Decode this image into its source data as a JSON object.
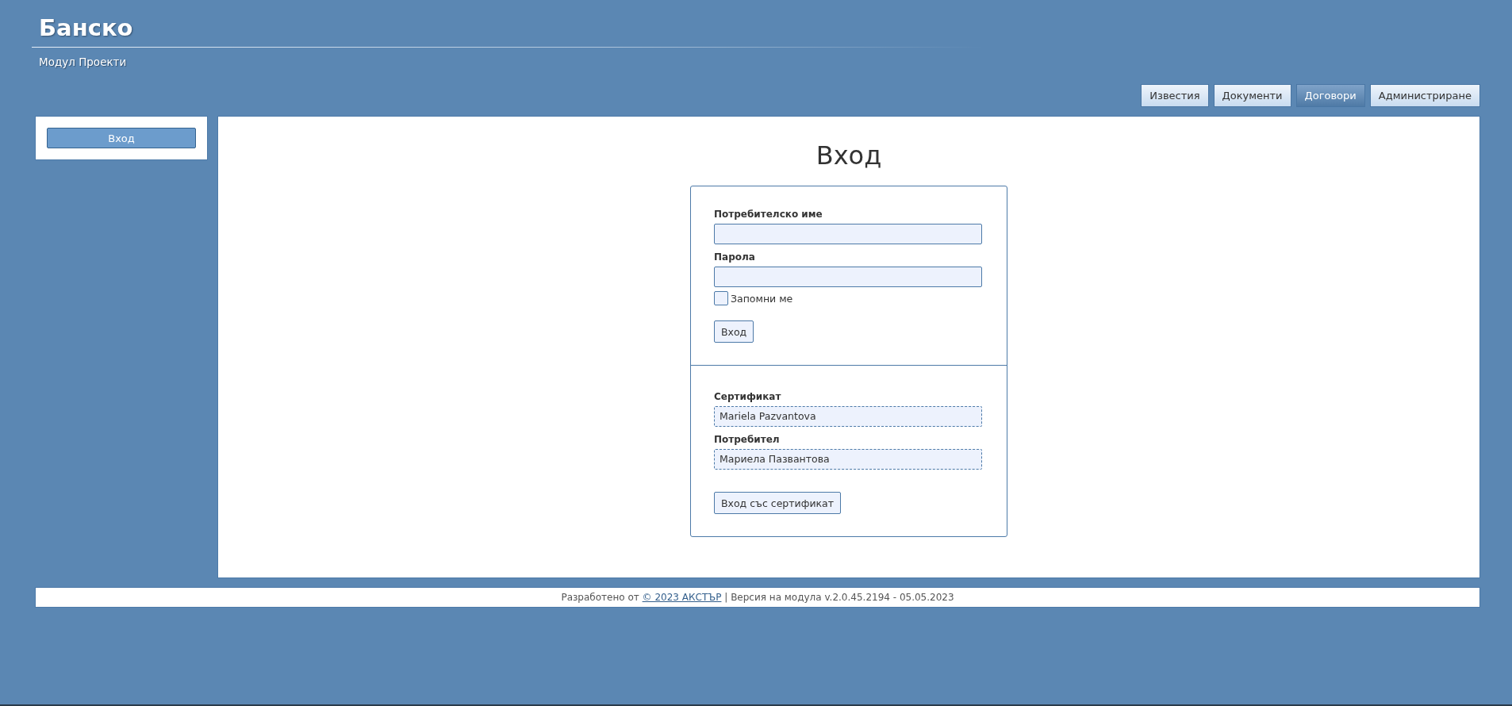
{
  "header": {
    "title": "Банско",
    "subtitle": "Модул Проекти"
  },
  "tabs": [
    {
      "label": "Известия",
      "selected": false
    },
    {
      "label": "Документи",
      "selected": false
    },
    {
      "label": "Договори",
      "selected": true
    },
    {
      "label": "Администриране",
      "selected": false
    }
  ],
  "sidebar": {
    "items": [
      {
        "label": "Вход"
      }
    ]
  },
  "main": {
    "heading": "Вход",
    "login": {
      "username_label": "Потребителско име",
      "password_label": "Парола",
      "remember": {
        "label": "Запомни ме",
        "checked": false
      },
      "button": "Вход"
    },
    "certificate": {
      "certificate_label": "Сертификат",
      "certificate_value": "Mariela Pazvantova",
      "user_label": "Потребител",
      "user_value": "Мариела Пазвантова",
      "button": "Вход със сертификат"
    }
  },
  "footer": {
    "prefix": "Разработено от",
    "link": "© 2023 АКСТЪР",
    "suffix": "| Версия на модула v.2.0.45.2194 - 05.05.2023"
  }
}
